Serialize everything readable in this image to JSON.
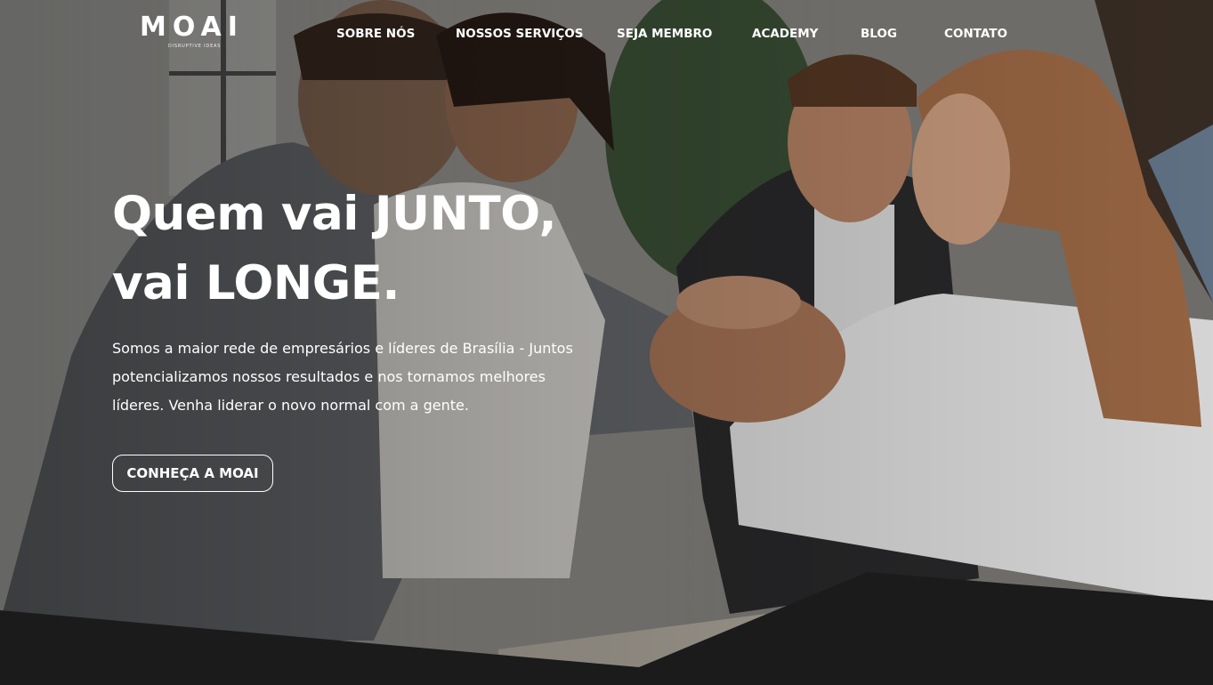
{
  "brand": {
    "name": "MOAI",
    "tagline": "DISRUPTIVE IDEAS"
  },
  "nav": {
    "items": [
      {
        "label": "SOBRE NÓS"
      },
      {
        "label": "NOSSOS SERVIÇOS"
      },
      {
        "label": "SEJA MEMBRO"
      },
      {
        "label": "ACADEMY"
      },
      {
        "label": "BLOG"
      },
      {
        "label": "CONTATO"
      }
    ]
  },
  "hero": {
    "headline_line1": "Quem vai JUNTO,",
    "headline_line2": "vai LONGE.",
    "description_line1": "Somos a maior rede de empresários e líderes de Brasília - Juntos",
    "description_line2": "potencializamos nossos resultados e nos tornamos melhores",
    "description_line3": "líderes. Venha liderar o novo normal com a gente.",
    "cta_label": "CONHEÇA A MOAI",
    "background_image": "team-hands-stacked-photo"
  },
  "colors": {
    "text": "#ffffff",
    "footer_band": "#1b1b1b"
  }
}
